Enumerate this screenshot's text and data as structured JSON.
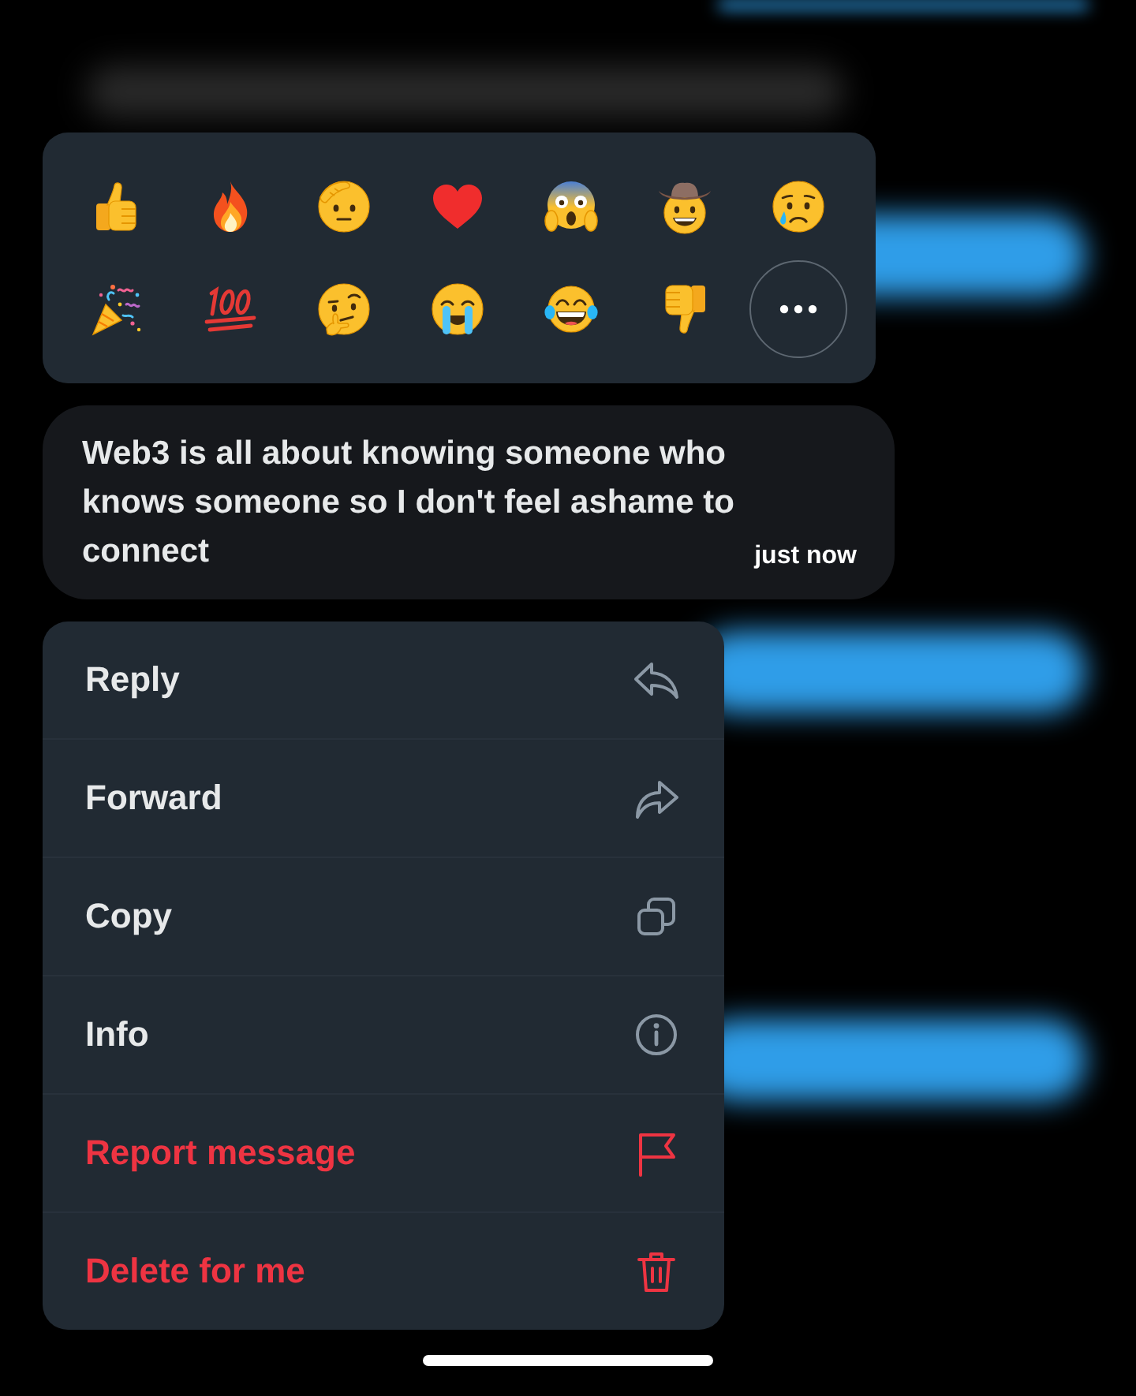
{
  "reactions": [
    {
      "kind": "thumbs_up"
    },
    {
      "kind": "fire"
    },
    {
      "kind": "saluting_face"
    },
    {
      "kind": "red_heart"
    },
    {
      "kind": "screaming_face"
    },
    {
      "kind": "cowboy_face"
    },
    {
      "kind": "crying_face"
    },
    {
      "kind": "party_popper"
    },
    {
      "kind": "hundred_points"
    },
    {
      "kind": "thinking_face"
    },
    {
      "kind": "sobbing_face"
    },
    {
      "kind": "tears_of_joy"
    },
    {
      "kind": "thumbs_down"
    },
    {
      "kind": "more"
    }
  ],
  "message": {
    "text": "Web3 is all about knowing someone who knows someone so I don't feel ashame to connect",
    "time": "just now"
  },
  "menu": {
    "items": [
      {
        "label": "Reply",
        "kind": "reply",
        "destructive": false
      },
      {
        "label": "Forward",
        "kind": "forward",
        "destructive": false
      },
      {
        "label": "Copy",
        "kind": "copy",
        "destructive": false
      },
      {
        "label": "Info",
        "kind": "info",
        "destructive": false
      },
      {
        "label": "Report message",
        "kind": "report",
        "destructive": true
      },
      {
        "label": "Delete for me",
        "kind": "delete",
        "destructive": true
      }
    ]
  }
}
